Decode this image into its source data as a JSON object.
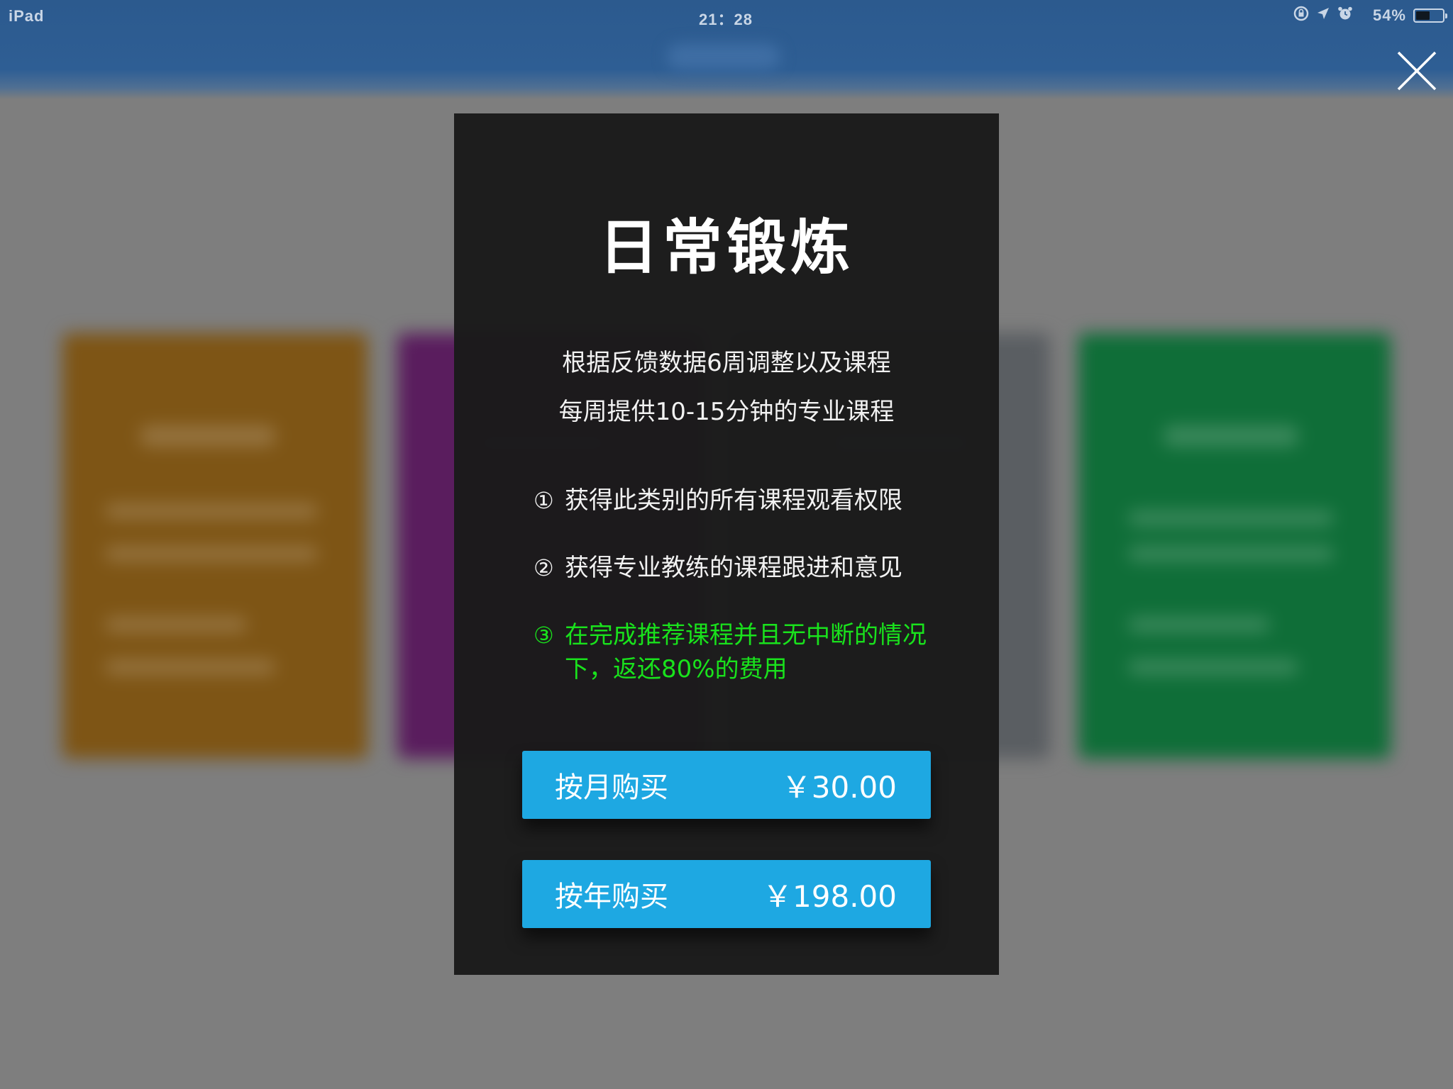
{
  "status_bar": {
    "device": "iPad",
    "time": "21：28",
    "battery_percent": "54%",
    "battery_level": 0.54,
    "icons": [
      "rotation-lock-icon",
      "location-arrow-icon",
      "alarm-clock-icon",
      "battery-icon"
    ]
  },
  "modal": {
    "title": "日常锻炼",
    "description": [
      "根据反馈数据6周调整以及课程",
      "每周提供10-15分钟的专业课程"
    ],
    "benefits": [
      {
        "num": "①",
        "text": "获得此类别的所有课程观看权限",
        "highlight": false
      },
      {
        "num": "②",
        "text": "获得专业教练的课程跟进和意见",
        "highlight": false
      },
      {
        "num": "③",
        "text": "在完成推荐课程并且无中断的情况下，返还80%的费用",
        "highlight": true
      }
    ],
    "purchase_options": [
      {
        "label": "按月购买",
        "price": "￥30.00"
      },
      {
        "label": "按年购买",
        "price": "￥198.00"
      }
    ]
  },
  "colors": {
    "header_blue": "#2e5e94",
    "modal_bg": "#1a1a1a",
    "button_blue": "#1ea8e2",
    "highlight_green": "#19e21c",
    "card_orange": "#7e5515",
    "card_purple": "#5a1d5e",
    "card_gray": "#5a5e62",
    "card_green": "#0f6e38"
  }
}
